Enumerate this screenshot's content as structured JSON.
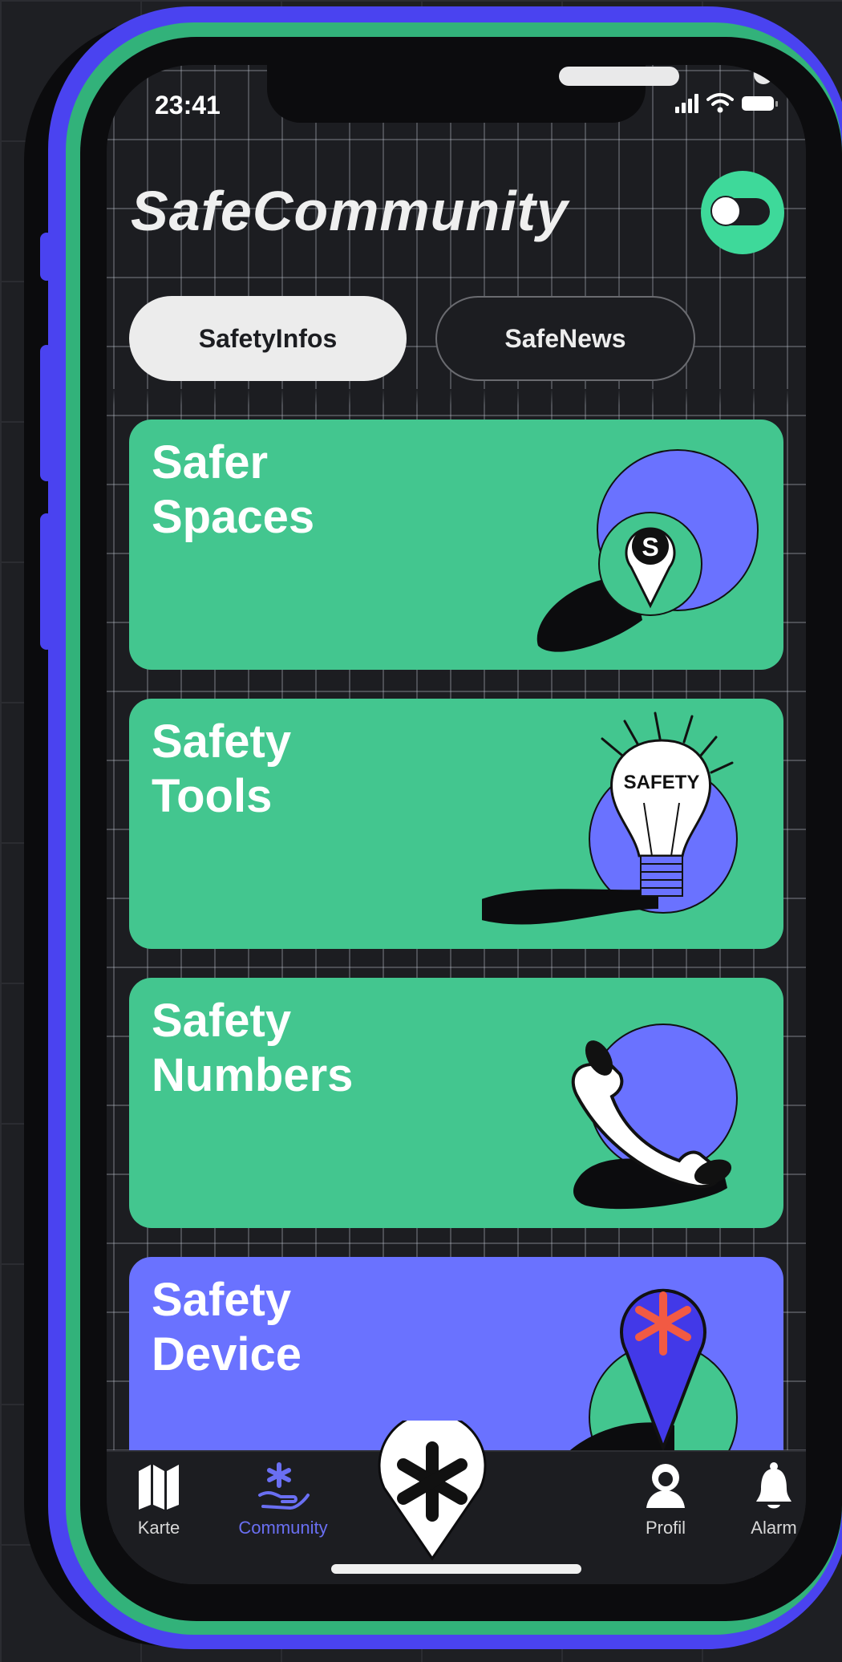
{
  "status_bar": {
    "time": "23:41"
  },
  "header": {
    "app_title": "SafeCommunity",
    "toggle_icon": "toggle-icon"
  },
  "segmented": {
    "tabs": [
      {
        "label": "SafetyInfos",
        "active": true
      },
      {
        "label": "SafeNews",
        "active": false
      }
    ]
  },
  "cards": [
    {
      "label": "Safer\nSpaces",
      "color": "#43c68f",
      "icon": "location-pin-s-icon",
      "icon_text": "S"
    },
    {
      "label": "Safety\nTools",
      "color": "#43c68f",
      "icon": "lightbulb-icon",
      "icon_text": "SAFETY"
    },
    {
      "label": "Safety\nNumbers",
      "color": "#43c68f",
      "icon": "phone-handset-icon"
    },
    {
      "label": "Safety\nDevice",
      "color": "#6a72ff",
      "icon": "asterisk-pin-icon"
    }
  ],
  "bottom_nav": {
    "items": [
      {
        "label": "Karte",
        "icon": "map-icon",
        "active": false
      },
      {
        "label": "Community",
        "icon": "community-hand-icon",
        "active": true
      },
      {
        "label": "Profil",
        "icon": "profile-icon",
        "active": false
      },
      {
        "label": "Alarm",
        "icon": "bell-icon",
        "active": false
      }
    ],
    "center_button": {
      "icon": "asterisk-icon"
    }
  },
  "colors": {
    "accent_green": "#43c68f",
    "accent_purple": "#6a72ff",
    "active_nav": "#6a6ff2",
    "frame_blue": "#4a43f0"
  }
}
